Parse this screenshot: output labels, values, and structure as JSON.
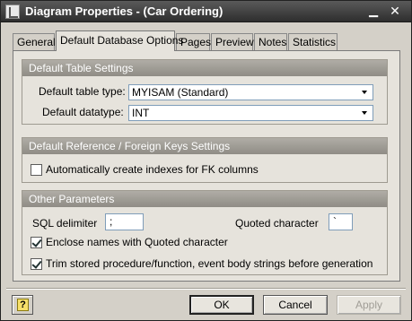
{
  "window": {
    "title": "Diagram Properties - (Car Ordering)",
    "minimize_glyph": "▁",
    "close_glyph": "✕"
  },
  "tabs": [
    {
      "label": "General"
    },
    {
      "label": "Default Database Options",
      "active": true
    },
    {
      "label": "Pages"
    },
    {
      "label": "Preview"
    },
    {
      "label": "Notes"
    },
    {
      "label": "Statistics"
    }
  ],
  "table_settings": {
    "title": "Default Table Settings",
    "table_type_label": "Default table type:",
    "table_type_value": "MYISAM (Standard)",
    "datatype_label": "Default datatype:",
    "datatype_value": "INT"
  },
  "fk_settings": {
    "title": "Default Reference / Foreign Keys Settings",
    "auto_index_label": "Automatically create indexes for FK columns",
    "auto_index_checked": false
  },
  "other_params": {
    "title": "Other Parameters",
    "sql_delimiter_label": "SQL delimiter",
    "sql_delimiter_value": ";",
    "quoted_char_label": "Quoted character",
    "quoted_char_value": "`",
    "enclose_label": "Enclose names with Quoted character",
    "enclose_checked": true,
    "trim_label": "Trim stored procedure/function, event body strings before generation",
    "trim_checked": true
  },
  "footer": {
    "help_glyph": "?",
    "ok_label": "OK",
    "cancel_label": "Cancel",
    "apply_label": "Apply",
    "apply_enabled": false
  },
  "colors": {
    "titlebar": "#2e2e2e",
    "group_header": "#8f8c85",
    "panel": "#e6e3dc"
  }
}
